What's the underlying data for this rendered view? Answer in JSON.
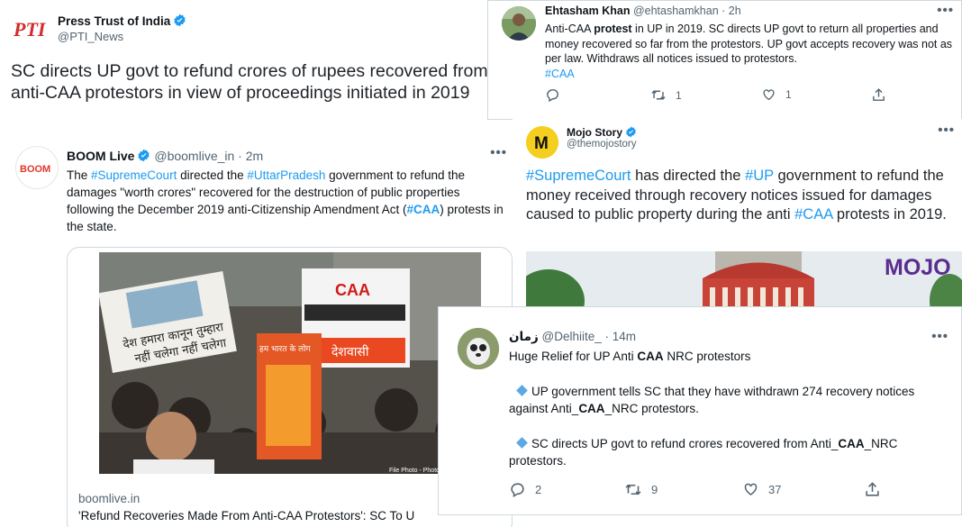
{
  "pti": {
    "logo_text": "PTI",
    "name": "Press Trust of India",
    "handle": "@PTI_News",
    "text": "SC directs UP govt to refund crores of rupees recovered from anti-CAA protestors in view of proceedings initiated in 2019"
  },
  "ehtasham": {
    "name": "Ehtasham Khan",
    "handle": "@ehtashamkhan",
    "sep": "·",
    "time": "2h",
    "text_pre": "Anti-CAA ",
    "text_bold": "protest",
    "text_post": " in UP in 2019. SC directs UP govt to return all properties and money recovered so far from the protestors. UP govt accepts recovery was not as per law. Withdraws all notices issued to protestors.",
    "hashtag": "#CAA",
    "retweets": "1",
    "likes": "1"
  },
  "boom": {
    "logo_text": "BOOM",
    "name": "BOOM Live",
    "handle": "@boomlive_in",
    "sep": "·",
    "time": "2m",
    "t1": "The ",
    "h1": "#SupremeCourt",
    "t2": " directed the ",
    "h2": "#UttarPradesh",
    "t3": " government to refund the damages \"worth crores\" recovered for the destruction of public properties following the December 2019 anti-Citizenship Amendment Act (",
    "h3": "#CAA",
    "t4": ") protests in the state.",
    "photo_text_1": "देश हमारा कानून तुम्हारा",
    "photo_text_2": "नहीं चलेगा  नहीं चलेगा",
    "photo_text_3": "CAA",
    "photo_text_4": "देशवासी",
    "photo_text_5": "हम भारत के लोग",
    "photo_credit": "File Photo -    Photo Credit : Hin",
    "link_domain": "boomlive.in",
    "link_title": "'Refund Recoveries Made From Anti-CAA Protestors': SC To U"
  },
  "mojo": {
    "logo_text": "M",
    "name": "Mojo Story",
    "handle": "@themojostory",
    "h1": "#SupremeCourt",
    "t1": " has directed the ",
    "h2": "#UP",
    "t2": " government to refund the money received through recovery notices issued for damages caused to public property during the anti ",
    "h3": "#CAA",
    "t3": " protests in 2019.",
    "media_logo": "MOJO"
  },
  "delhiite": {
    "name": "زمان",
    "handle": "@Delhiite_",
    "sep": "·",
    "time": "14m",
    "line1_pre": "Huge Relief for UP Anti ",
    "line1_bold": "CAA",
    "line1_post": " NRC protestors",
    "p2": "UP government tells SC that they have withdrawn 274 recovery notices against Anti_",
    "p2_bold": "CAA",
    "p2_post": "_NRC protestors.",
    "p3": "SC directs UP govt to refund crores recovered from Anti_",
    "p3_bold": "CAA",
    "p3_post": "_NRC protestors.",
    "replies": "2",
    "retweets": "9",
    "likes": "37"
  }
}
